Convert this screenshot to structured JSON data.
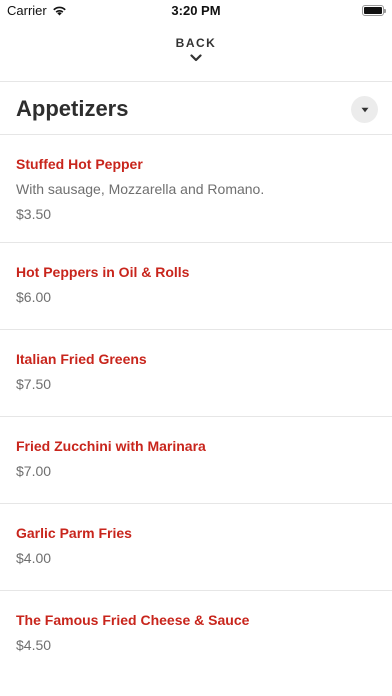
{
  "status_bar": {
    "carrier": "Carrier",
    "time": "3:20 PM",
    "icons": [
      "wifi-icon",
      "battery-icon"
    ]
  },
  "nav": {
    "back_label": "BACK",
    "back_icon": "chevron-down-icon"
  },
  "section": {
    "title": "Appetizers",
    "dropdown_icon": "caret-down-icon"
  },
  "items": [
    {
      "name": "Stuffed Hot Pepper",
      "description": "With sausage, Mozzarella and Romano.",
      "price": "$3.50"
    },
    {
      "name": "Hot Peppers in Oil & Rolls",
      "price": "$6.00"
    },
    {
      "name": "Italian Fried Greens",
      "price": "$7.50"
    },
    {
      "name": "Fried Zucchini with Marinara",
      "price": "$7.00"
    },
    {
      "name": "Garlic Parm Fries",
      "price": "$4.00"
    },
    {
      "name": "The Famous Fried Cheese & Sauce",
      "price": "$4.50"
    }
  ],
  "colors": {
    "item_name": "#c8251c",
    "secondary_text": "#6f6f6f",
    "divider": "#e6e6e6"
  }
}
